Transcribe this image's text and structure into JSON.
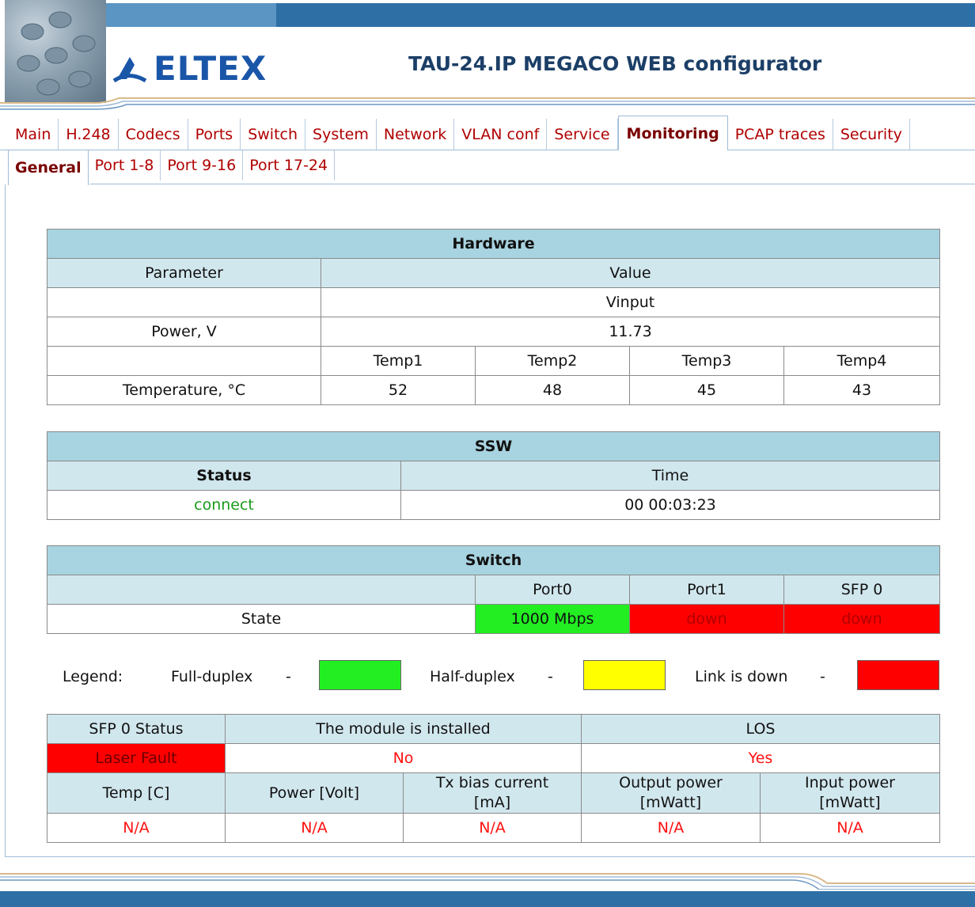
{
  "header": {
    "logo_text": "ELTEX",
    "app_title": "TAU-24.IP MEGACO WEB configurator"
  },
  "main_tabs": [
    {
      "label": "Main",
      "active": false
    },
    {
      "label": "H.248",
      "active": false
    },
    {
      "label": "Codecs",
      "active": false
    },
    {
      "label": "Ports",
      "active": false
    },
    {
      "label": "Switch",
      "active": false
    },
    {
      "label": "System",
      "active": false
    },
    {
      "label": "Network",
      "active": false
    },
    {
      "label": "VLAN conf",
      "active": false
    },
    {
      "label": "Service",
      "active": false
    },
    {
      "label": "Monitoring",
      "active": true
    },
    {
      "label": "PCAP traces",
      "active": false
    },
    {
      "label": "Security",
      "active": false
    }
  ],
  "sub_tabs": [
    {
      "label": "General",
      "active": true
    },
    {
      "label": "Port 1-8",
      "active": false
    },
    {
      "label": "Port 9-16",
      "active": false
    },
    {
      "label": "Port 17-24",
      "active": false
    }
  ],
  "hardware": {
    "title": "Hardware",
    "col_parameter": "Parameter",
    "col_value": "Value",
    "vinput_label": "Vinput",
    "power_label": "Power, V",
    "power_value": "11.73",
    "temp_headers": [
      "Temp1",
      "Temp2",
      "Temp3",
      "Temp4"
    ],
    "temp_label": "Temperature, °C",
    "temp_values": [
      "52",
      "48",
      "45",
      "43"
    ]
  },
  "ssw": {
    "title": "SSW",
    "col_status": "Status",
    "col_time": "Time",
    "status_value": "connect",
    "time_value": "00 00:03:23"
  },
  "switch": {
    "title": "Switch",
    "ports": [
      "Port0",
      "Port1",
      "SFP 0"
    ],
    "state_label": "State",
    "states": [
      "1000 Mbps",
      "down",
      "down"
    ]
  },
  "legend": {
    "label": "Legend:",
    "full_duplex": "Full-duplex",
    "half_duplex": "Half-duplex",
    "link_down": "Link is down",
    "dash": "-",
    "colors": {
      "full": "#22ee22",
      "half": "#ffff00",
      "down": "#ff0000"
    }
  },
  "sfp": {
    "status_header": "SFP 0 Status",
    "installed_header": "The module is installed",
    "los_header": "LOS",
    "status_value": "Laser Fault",
    "installed_value": "No",
    "los_value": "Yes",
    "col_temp": "Temp [C]",
    "col_power": "Power [Volt]",
    "col_tx_1": "Tx bias current",
    "col_tx_2": "[mA]",
    "col_out_1": "Output power",
    "col_out_2": "[mWatt]",
    "col_in_1": "Input power",
    "col_in_2": "[mWatt]",
    "values": [
      "N/A",
      "N/A",
      "N/A",
      "N/A",
      "N/A"
    ]
  },
  "colors": {
    "accent_blue": "#2e6fa5",
    "tab_red": "#b00000",
    "table_title": "#a8d3e0",
    "table_header": "#d1e7ee"
  }
}
